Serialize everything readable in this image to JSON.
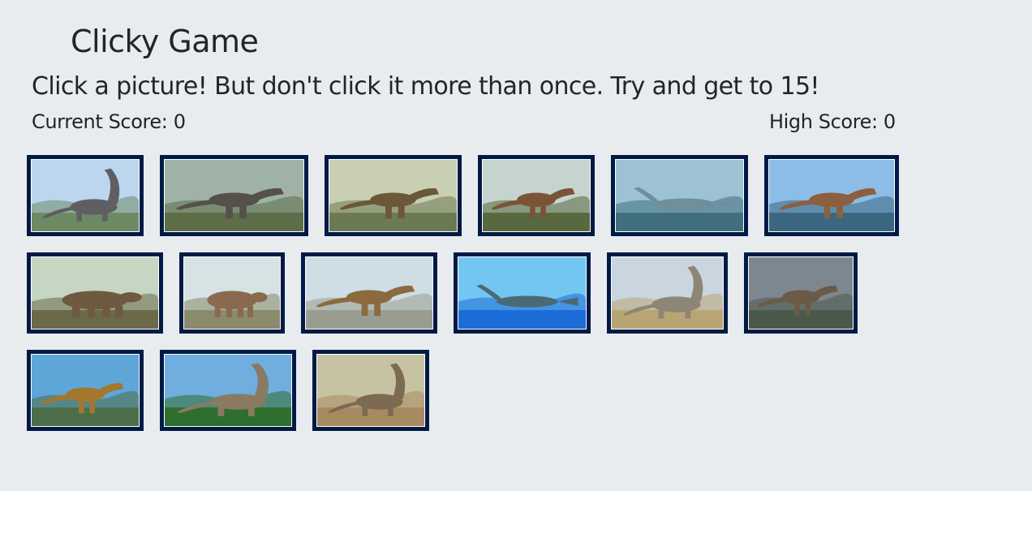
{
  "header": {
    "title": "Clicky Game",
    "instructions": "Click a picture! But don't click it more than once. Try and get to 15!"
  },
  "scores": {
    "current_label": "Current Score: 0",
    "high_label": "High Score: 0",
    "current": 0,
    "high": 0,
    "goal": 15
  },
  "colors": {
    "background": "#e9ecef",
    "card_border": "#001a45"
  },
  "cards": [
    {
      "name": "sauropod-herd-card",
      "sky": "#bcd6ee",
      "ground": "#6e8a64",
      "creature": "#5f5f63",
      "kind": "longneck"
    },
    {
      "name": "trex-jungle-card",
      "sky": "#9eb3a6",
      "ground": "#5d6d48",
      "creature": "#55514a",
      "kind": "biped"
    },
    {
      "name": "trex-triceratops-card",
      "sky": "#c9cfb2",
      "ground": "#6c7a54",
      "creature": "#6a5838",
      "kind": "biped"
    },
    {
      "name": "trex-roaring-card",
      "sky": "#c6d4cf",
      "ground": "#58683f",
      "creature": "#7b5438",
      "kind": "biped"
    },
    {
      "name": "spinosaurus-swimming-card",
      "sky": "#9cc2d4",
      "ground": "#3f6f7d",
      "creature": "#6e8f9b",
      "kind": "swimmer"
    },
    {
      "name": "spinosaurus-river-card",
      "sky": "#8cbde6",
      "ground": "#3a6680",
      "creature": "#8c5f3e",
      "kind": "biped"
    },
    {
      "name": "ankylosaurus-card",
      "sky": "#c5d6c2",
      "ground": "#6a6a48",
      "creature": "#6f5940",
      "kind": "quadruped"
    },
    {
      "name": "triceratops-card",
      "sky": "#d6e2e4",
      "ground": "#8a8a6c",
      "creature": "#8a6a4e",
      "kind": "quadruped"
    },
    {
      "name": "allosaurus-shore-card",
      "sky": "#cfdde4",
      "ground": "#9a9c90",
      "creature": "#8b6a3e",
      "kind": "biped"
    },
    {
      "name": "plesiosaur-underwater-card",
      "sky": "#74c6f2",
      "ground": "#1b6cd6",
      "creature": "#4a6a73",
      "kind": "swimmer"
    },
    {
      "name": "brachiosaurus-pair-card",
      "sky": "#c9d6df",
      "ground": "#b9a473",
      "creature": "#8e8674",
      "kind": "longneck"
    },
    {
      "name": "trex-crocodile-card",
      "sky": "#7d8790",
      "ground": "#4a5a4a",
      "creature": "#6b5a48",
      "kind": "biped"
    },
    {
      "name": "trex-standing-card",
      "sky": "#5fa6d8",
      "ground": "#4c6e4a",
      "creature": "#a3772e",
      "kind": "biped"
    },
    {
      "name": "brachiosaurus-forest-card",
      "sky": "#6faede",
      "ground": "#2f6e2c",
      "creature": "#8a7a62",
      "kind": "longneck"
    },
    {
      "name": "dinosaur-valley-card",
      "sky": "#c6c3a2",
      "ground": "#a78a60",
      "creature": "#7d6a52",
      "kind": "longneck"
    }
  ]
}
